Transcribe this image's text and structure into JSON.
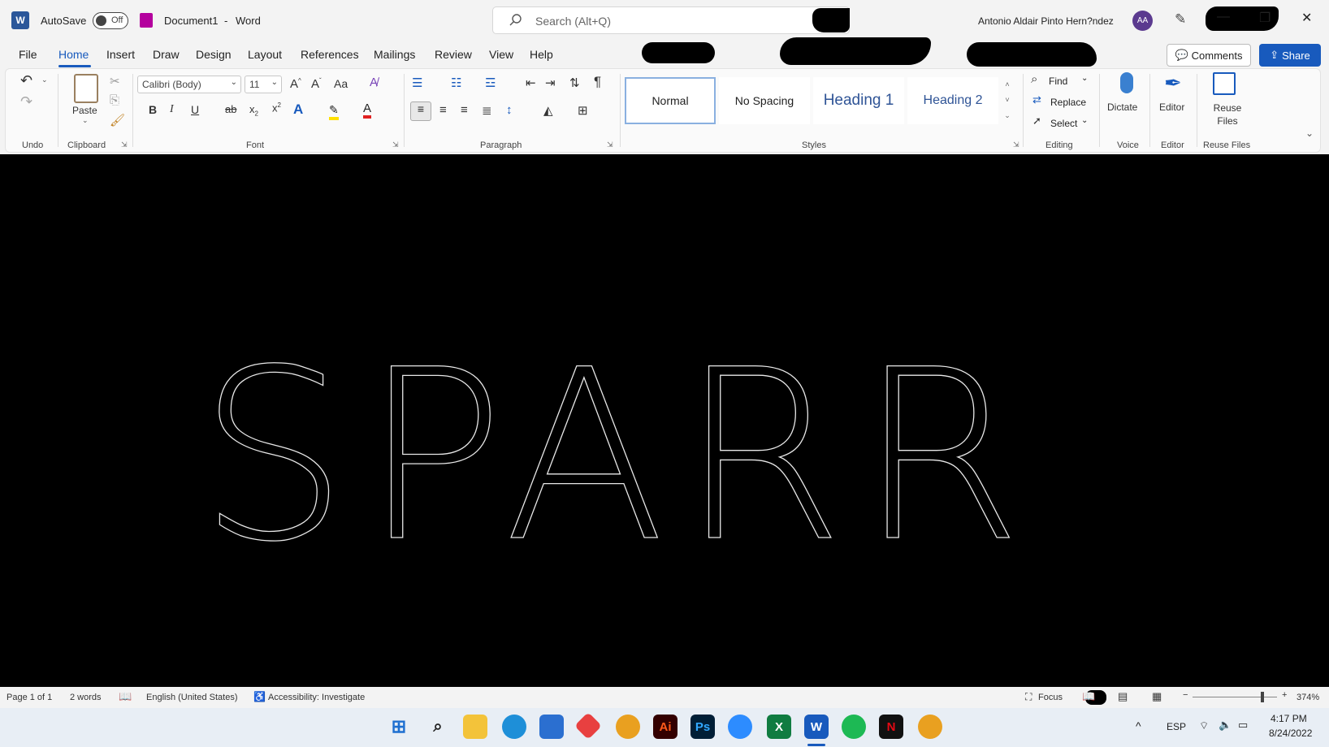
{
  "window": {
    "autosave_label": "AutoSave",
    "autosave_state": "Off",
    "doc_title": "Document1",
    "separator": "-",
    "app_name": "Word",
    "search_placeholder": "Search (Alt+Q)",
    "user_name": "Antonio Aldair Pinto Hern?ndez",
    "user_initials": "AA"
  },
  "menu": {
    "items": [
      "File",
      "Home",
      "Insert",
      "Draw",
      "Design",
      "Layout",
      "References",
      "Mailings",
      "Review",
      "View",
      "Help"
    ],
    "active": "Home",
    "comments_label": "Comments",
    "share_label": "Share"
  },
  "ribbon": {
    "font_name": "Calibri (Body)",
    "font_size": "11",
    "paste_label": "Paste",
    "styles": [
      "Normal",
      "No Spacing",
      "Heading 1",
      "Heading 2"
    ],
    "find_label": "Find",
    "replace_label": "Replace",
    "select_label": "Select",
    "dictate_label": "Dictate",
    "editor_label": "Editor",
    "reuse_label": "Reuse Files",
    "groups": {
      "undo": "Undo",
      "clipboard": "Clipboard",
      "font": "Font",
      "paragraph": "Paragraph",
      "styles": "Styles",
      "editing": "Editing",
      "voice": "Voice",
      "editor": "Editor",
      "reuse": "Reuse Files"
    },
    "font_buttons": {
      "bold": "B",
      "italic": "I",
      "underline": "U",
      "strike": "ab",
      "change_case": "Aa"
    }
  },
  "document": {
    "text": "SPARR"
  },
  "status": {
    "page": "Page 1 of 1",
    "words": "2 words",
    "language": "English (United States)",
    "accessibility": "Accessibility: Investigate",
    "focus": "Focus",
    "zoom": "374%"
  },
  "taskbar": {
    "language": "ESP",
    "time": "4:17 PM",
    "date": "8/24/2022"
  },
  "colors": {
    "accent": "#185abd",
    "ribbon_bg": "#f3f3f3",
    "doc_bg": "#000000",
    "heading_blue": "#2f5496"
  }
}
